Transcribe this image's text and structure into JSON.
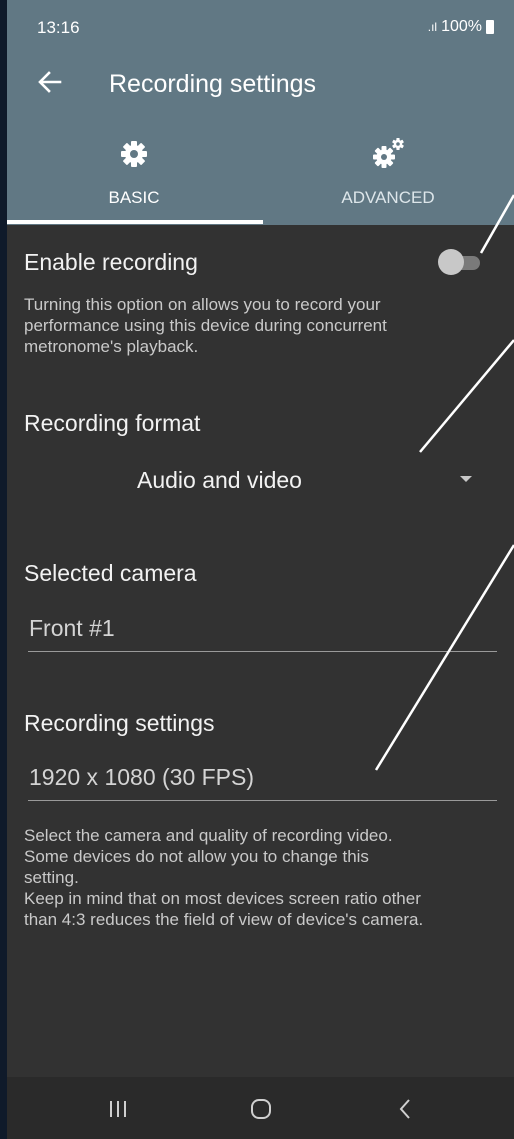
{
  "status": {
    "time": "13:16",
    "signal": ".ıl",
    "battery": "100%"
  },
  "header": {
    "title": "Recording settings"
  },
  "tabs": [
    {
      "label": "BASIC",
      "icon": "gear-icon",
      "selected": true
    },
    {
      "label": "ADVANCED",
      "icon": "gears-icon",
      "selected": false
    }
  ],
  "settings": {
    "enable_recording": {
      "label": "Enable recording",
      "enabled": false,
      "description": [
        "Turning this option on allows you to record your",
        "performance using this device during concurrent",
        "metronome's playback."
      ]
    },
    "recording_format": {
      "label": "Recording format",
      "value": "Audio and video"
    },
    "selected_camera": {
      "label": "Selected camera",
      "value": "Front #1"
    },
    "recording_settings": {
      "label": "Recording settings",
      "value": "1920 x 1080 (30 FPS)"
    },
    "help": [
      "Select the camera and quality of recording video.",
      "Some devices do not allow you to change this",
      "setting.",
      "Keep in mind that on most devices screen ratio other",
      "than 4:3 reduces the field of view of device's camera."
    ]
  },
  "navbar": {
    "recent": "recents-icon",
    "home": "home-icon",
    "back": "back-icon"
  },
  "colors": {
    "header": "#617884",
    "background": "#323232",
    "outer": "#0f1a2a"
  }
}
